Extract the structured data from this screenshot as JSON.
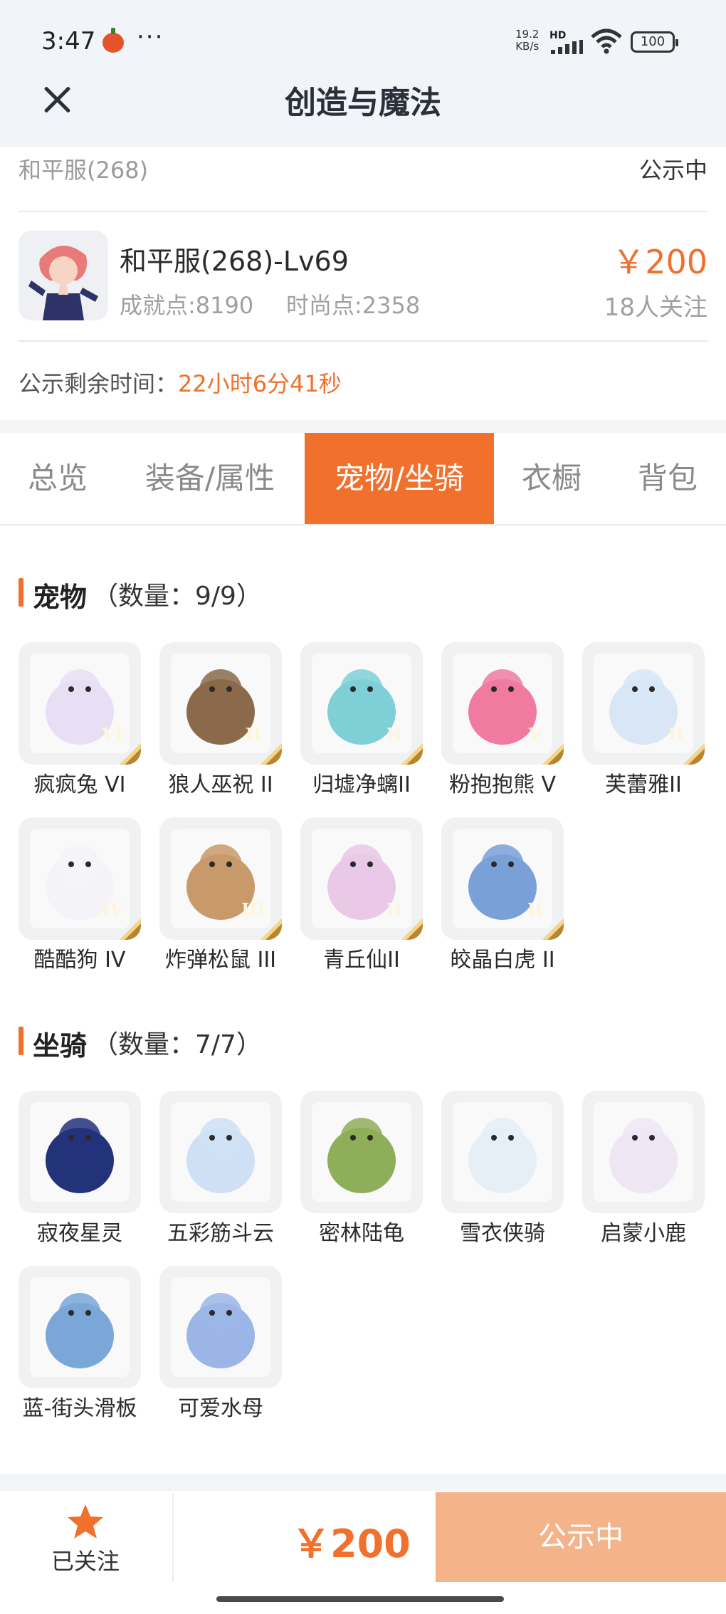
{
  "status_bar": {
    "time": "3:47",
    "net_speed_value": "19.2",
    "net_speed_unit": "KB/s",
    "hd": "HD",
    "battery": "100"
  },
  "header": {
    "title": "创造与魔法"
  },
  "info": {
    "server": "和平服(268)",
    "status": "公示中",
    "character_name": "和平服(268)-Lv69",
    "achievement": "成就点:8190",
    "fashion": "时尚点:2358",
    "price": "￥200",
    "followers": "18人关注",
    "remaining_label": "公示剩余时间：",
    "remaining_value": "22小时6分41秒"
  },
  "tabs": [
    {
      "label": "总览",
      "active": false
    },
    {
      "label": "装备/属性",
      "active": false
    },
    {
      "label": "宠物/坐骑",
      "active": true
    },
    {
      "label": "衣橱",
      "active": false
    },
    {
      "label": "背包",
      "active": false
    }
  ],
  "pets": {
    "title": "宠物",
    "count": "（数量：9/9）",
    "items": [
      {
        "name": "疯疯兔 VI",
        "badge": "VI",
        "icon": "rabbit-icon",
        "color": "#e9dff5"
      },
      {
        "name": "狼人巫祝 II",
        "badge": "II",
        "icon": "werewolf-icon",
        "color": "#8a6a4a"
      },
      {
        "name": "归墟净螭II",
        "badge": "II",
        "icon": "dragon-icon",
        "color": "#7fd0d6"
      },
      {
        "name": "粉抱抱熊 V",
        "badge": "V",
        "icon": "bear-icon",
        "color": "#f07aa0"
      },
      {
        "name": "芙蕾雅II",
        "badge": "II",
        "icon": "goddess-icon",
        "color": "#d8e6f6"
      },
      {
        "name": "酷酷狗 IV",
        "badge": "IV",
        "icon": "dog-icon",
        "color": "#f4f4f8"
      },
      {
        "name": "炸弹松鼠 III",
        "badge": "III",
        "icon": "squirrel-icon",
        "color": "#c89a6a"
      },
      {
        "name": "青丘仙II",
        "badge": "II",
        "icon": "fox-fairy-icon",
        "color": "#e9c9e6"
      },
      {
        "name": "皎晶白虎 II",
        "badge": "II",
        "icon": "tiger-icon",
        "color": "#7aa0d8"
      }
    ]
  },
  "mounts": {
    "title": "坐骑",
    "count": "（数量：7/7）",
    "items": [
      {
        "name": "寂夜星灵",
        "icon": "star-spirit-icon",
        "color": "#23337a"
      },
      {
        "name": "五彩筋斗云",
        "icon": "cloud-icon",
        "color": "#cfe0f4"
      },
      {
        "name": "密林陆龟",
        "icon": "tortoise-icon",
        "color": "#8fae5a"
      },
      {
        "name": "雪衣侠骑",
        "icon": "horse-icon",
        "color": "#e6eef6"
      },
      {
        "name": "启蒙小鹿",
        "icon": "deer-icon",
        "color": "#efe6f4"
      },
      {
        "name": "蓝-街头滑板",
        "icon": "skateboard-icon",
        "color": "#7aa6d8"
      },
      {
        "name": "可爱水母",
        "icon": "jellyfish-icon",
        "color": "#9bb6e6"
      }
    ]
  },
  "bottom_bar": {
    "follow_label": "已关注",
    "price": "￥200",
    "status_button": "公示中"
  },
  "colors": {
    "accent": "#f0702c",
    "button_muted": "#f4b389"
  }
}
